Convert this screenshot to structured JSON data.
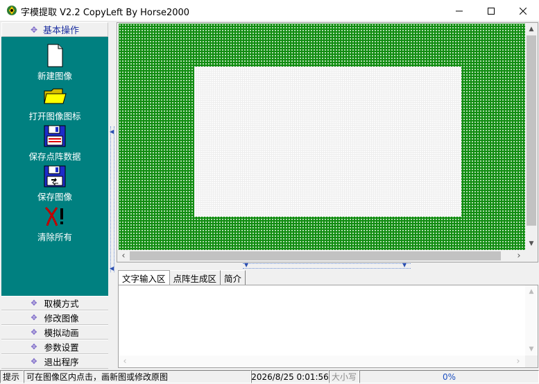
{
  "window": {
    "title": "字模提取 V2.2  CopyLeft By Horse2000"
  },
  "sidebar": {
    "section_title": "基本操作",
    "tools": [
      {
        "label": "新建图像",
        "icon": "new-document-icon"
      },
      {
        "label": "打开图像图标",
        "icon": "open-folder-icon"
      },
      {
        "label": "保存点阵数据",
        "icon": "save-data-disk-icon"
      },
      {
        "label": "保存图像",
        "icon": "save-image-disk-icon"
      },
      {
        "label": "清除所有",
        "icon": "clear-all-icon"
      }
    ],
    "sections": [
      {
        "label": "取模方式"
      },
      {
        "label": "修改图像"
      },
      {
        "label": "模拟动画"
      },
      {
        "label": "参数设置"
      },
      {
        "label": "退出程序"
      }
    ]
  },
  "tabs": [
    {
      "label": "文字输入区",
      "active": true
    },
    {
      "label": "点阵生成区",
      "active": false
    },
    {
      "label": "简介",
      "active": false
    }
  ],
  "status": {
    "hint_label": "提示",
    "hint_text": "可在图像区内点击，画新图或修改原图",
    "datetime": "2026/8/25 0:01:56",
    "caps": "大小写",
    "progress": "0%"
  },
  "colors": {
    "sidebar_bg": "#008080",
    "grid_green": "#118c11",
    "accent_blue": "#1c2fa0"
  }
}
